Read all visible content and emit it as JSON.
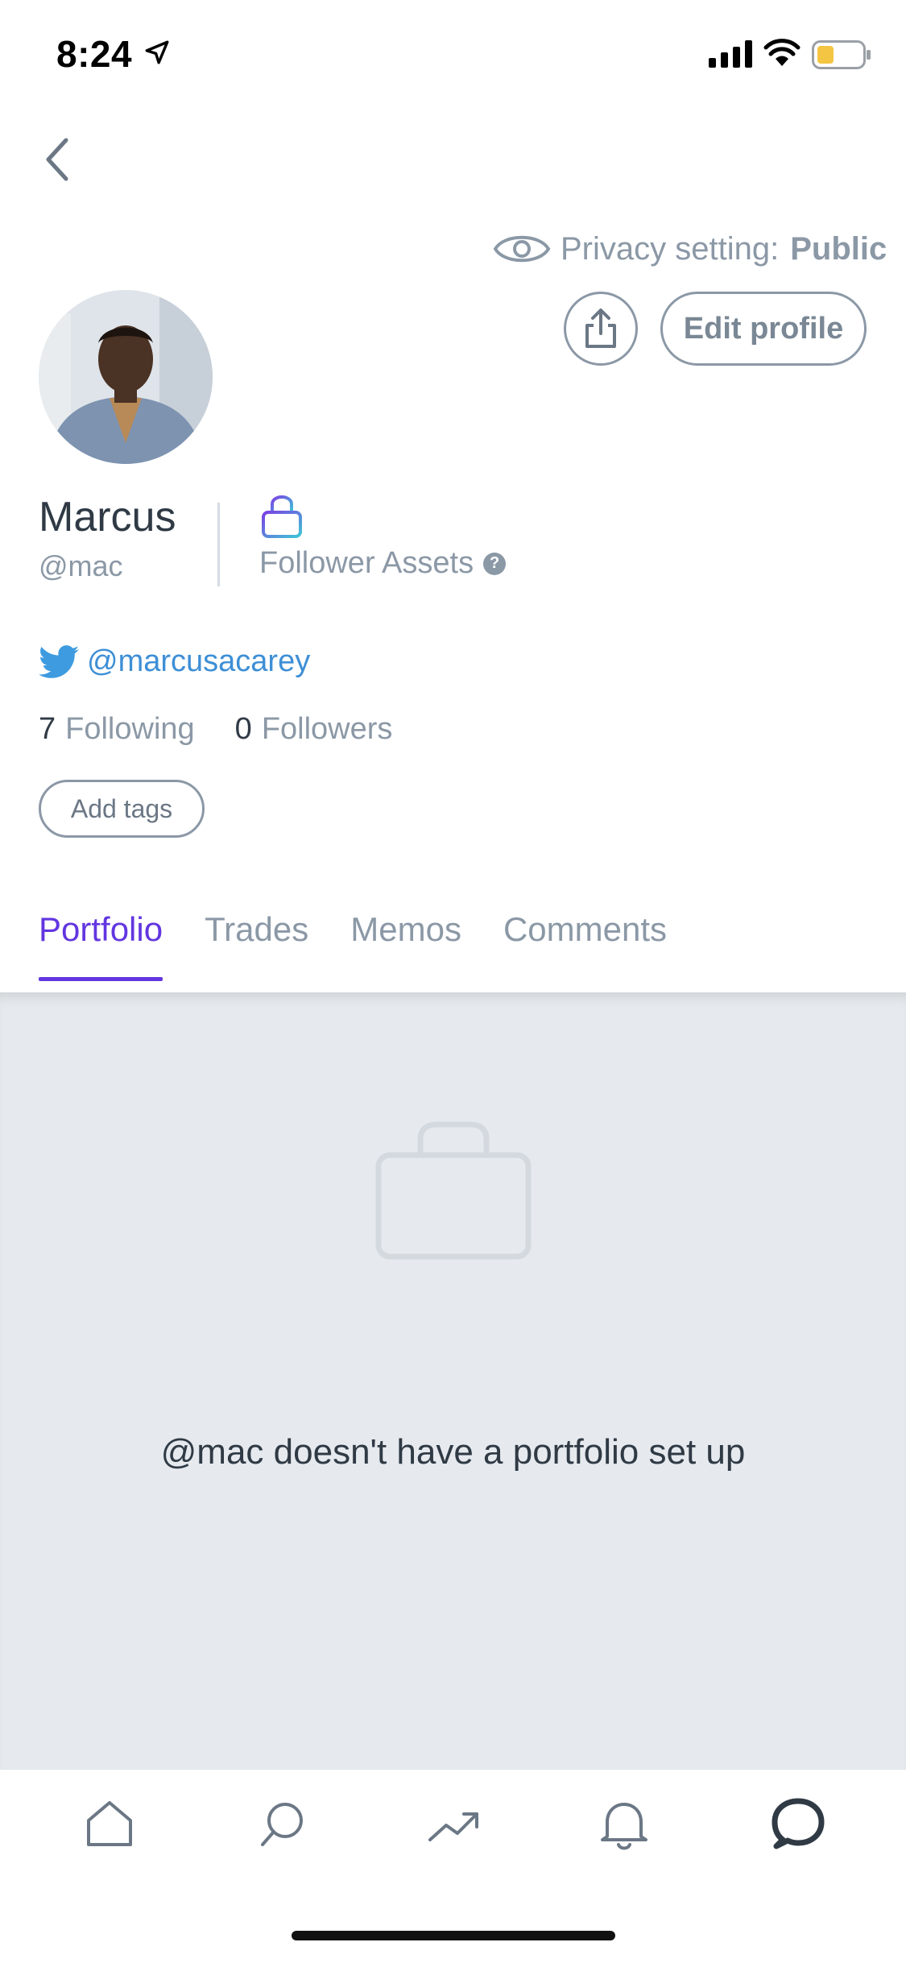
{
  "status_bar": {
    "time": "8:24"
  },
  "profile": {
    "privacy_label": "Privacy setting:",
    "privacy_value": "Public",
    "edit_profile_label": "Edit profile",
    "name": "Marcus",
    "handle": "@mac",
    "follower_assets_label": "Follower Assets",
    "help_mark": "?",
    "twitter_handle": "@marcusacarey",
    "following_count": "7",
    "following_label": "Following",
    "followers_count": "0",
    "followers_label": "Followers",
    "add_tags_label": "Add tags"
  },
  "tabs": [
    {
      "label": "Portfolio",
      "active": true
    },
    {
      "label": "Trades",
      "active": false
    },
    {
      "label": "Memos",
      "active": false
    },
    {
      "label": "Comments",
      "active": false
    }
  ],
  "empty_state": {
    "message": "@mac doesn't have a portfolio set up"
  },
  "nav": {
    "items": [
      "home-icon",
      "search-icon",
      "trending-icon",
      "bell-icon",
      "chat-icon"
    ],
    "active": "chat-icon"
  },
  "colors": {
    "accent": "#6236e0",
    "muted": "#8b98a6",
    "twitter": "#3e8fd6",
    "empty_bg": "#e6eaee"
  }
}
